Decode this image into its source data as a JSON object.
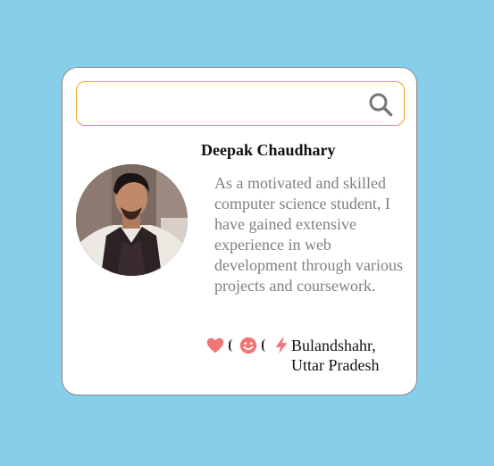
{
  "search": {
    "value": "",
    "placeholder": "",
    "icon": "search-icon"
  },
  "profile": {
    "name": "Deepak Chaudhary",
    "bio": "As a motivated and skilled computer science student, I have gained extensive experience in web development through various projects and coursework.",
    "location_line1": "Bulandshahr,",
    "location_line2": "Uttar Pradesh"
  },
  "icons": [
    "heart-icon",
    "smiley-icon",
    "lightning-icon"
  ],
  "colors": {
    "background": "#87ceeb",
    "card": "#ffffff",
    "search_border": "#f0a020",
    "icon_accent": "#f07575",
    "bio_text": "#808080"
  }
}
